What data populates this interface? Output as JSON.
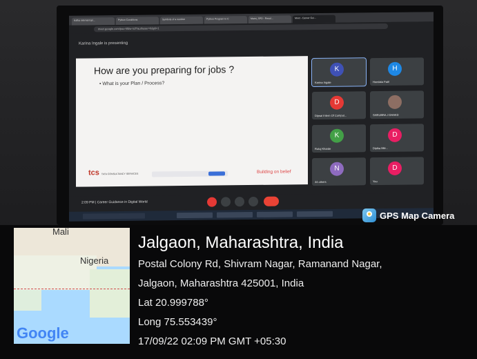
{
  "photo": {
    "browser_tabs": [
      "Kafka internal topi...",
      "Python Conditions",
      "Symbols of a number",
      "Python Program to C",
      "Maint_SPD - Resul...",
      "Meet - Career Gui..."
    ],
    "url": "meet.google.com/poo-hfdw-nzf?authuser=0&pli=1",
    "presenting_text": "Karina Ingale is presenting",
    "slide": {
      "title": "How are you preparing for jobs ?",
      "bullet": "• What is your Plan / Process?",
      "logo": "tcs",
      "logo_sub": "TATA CONSULTANCY SERVICES",
      "footer_right": "Building on belief"
    },
    "participants": [
      {
        "initial": "K",
        "name": "Karina Ingale",
        "color": "#3f51b5"
      },
      {
        "initial": "H",
        "name": "Hemlata Patil",
        "color": "#1e88e5"
      },
      {
        "initial": "D",
        "name": "Dipsai Intern Of Comput...",
        "color": "#e53935"
      },
      {
        "initial": "",
        "name": "SHRUBRA J DHAKD",
        "color": "#9e9e9e"
      },
      {
        "initial": "K",
        "name": "Rutuj Kharde",
        "color": "#43a047"
      },
      {
        "initial": "D",
        "name": "Dipika Mitr...",
        "color": "#e91e63"
      },
      {
        "initial": "N",
        "name": "44 others",
        "color": "#8e6bbf"
      },
      {
        "initial": "D",
        "name": "You",
        "color": "#e91e63"
      }
    ],
    "meet_bar": "2:09 PM | Career Guidance in Digital World"
  },
  "gps": {
    "app_label": "GPS Map Camera",
    "map_labels": [
      "Mali",
      "Nigeria"
    ],
    "map_brand": "Google",
    "city": "Jalgaon, Maharashtra, India",
    "address_line1": "Postal Colony Rd, Shivram Nagar, Ramanand Nagar,",
    "address_line2": "Jalgaon, Maharashtra 425001, India",
    "lat": "Lat 20.999788°",
    "long": "Long 75.553439°",
    "datetime": "17/09/22 02:09 PM GMT +05:30"
  }
}
